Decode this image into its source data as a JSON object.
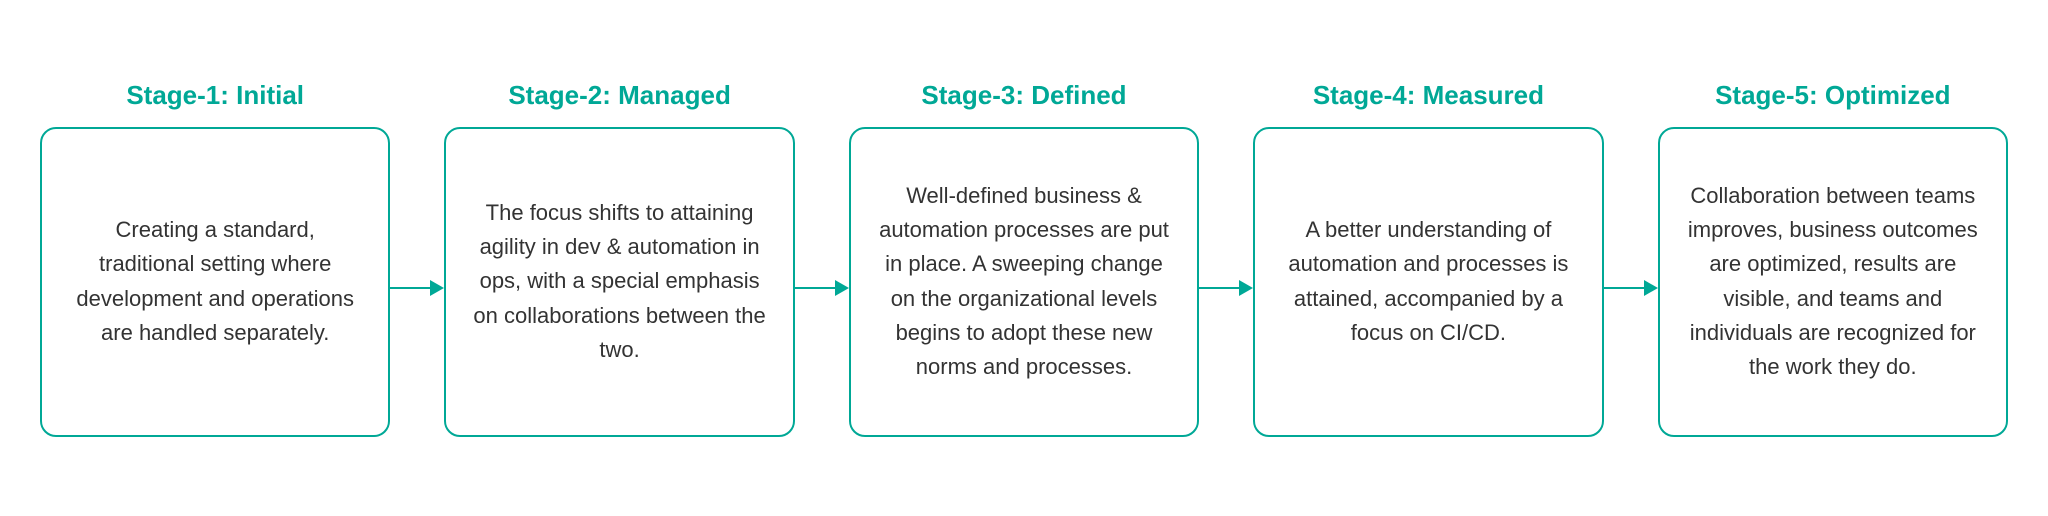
{
  "stages": [
    {
      "id": "stage-1",
      "title": "Stage-1: Initial",
      "content": "Creating a standard, traditional setting where development and operations are handled separately."
    },
    {
      "id": "stage-2",
      "title": "Stage-2: Managed",
      "content": "The focus shifts to attaining agility in dev & automation in ops, with a special emphasis on collaborations between the two."
    },
    {
      "id": "stage-3",
      "title": "Stage-3: Defined",
      "content": "Well-defined business & automation processes are put in place. A sweeping change on the organizational levels begins to adopt these new norms and processes."
    },
    {
      "id": "stage-4",
      "title": "Stage-4: Measured",
      "content": "A better understanding of automation and processes is attained, accompanied by a focus on CI/CD."
    },
    {
      "id": "stage-5",
      "title": "Stage-5: Optimized",
      "content": "Collaboration between teams improves, business outcomes are optimized, results are visible, and teams and individuals are recognized for the work they do."
    }
  ],
  "connector": {
    "aria_label": "arrow connector"
  }
}
